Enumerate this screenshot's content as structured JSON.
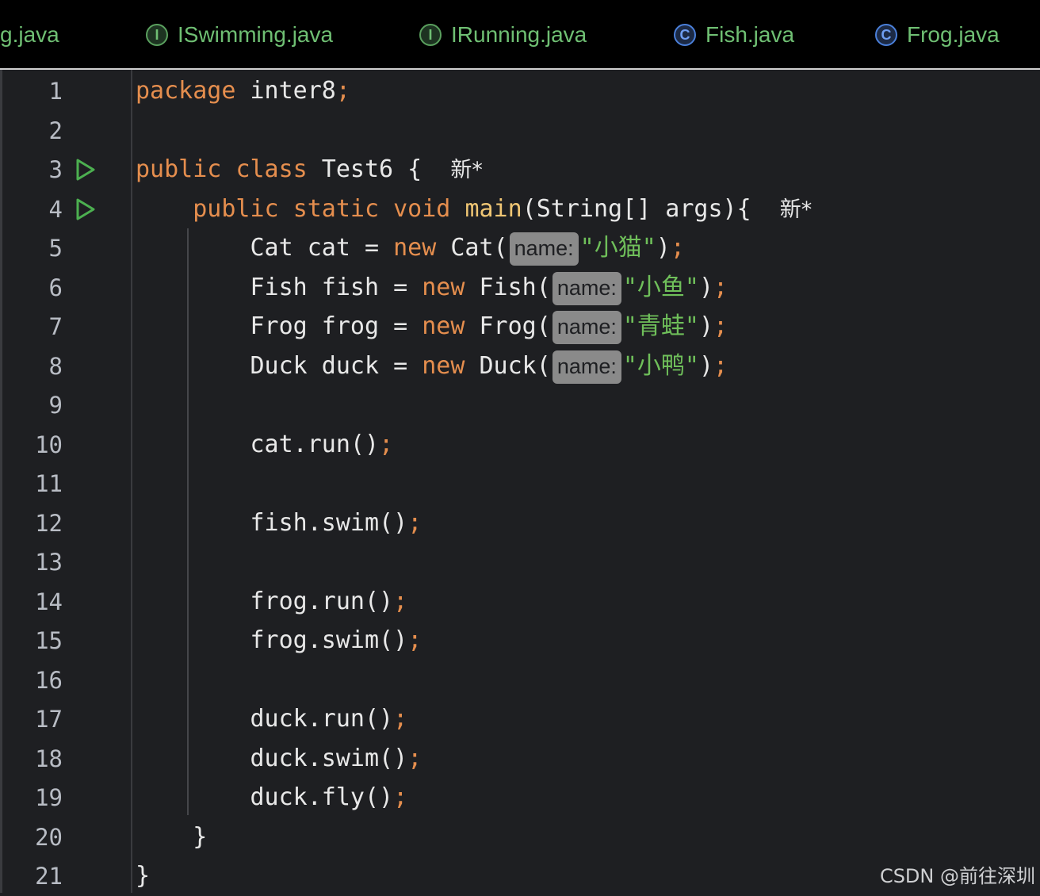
{
  "tabs": [
    {
      "label": "g.java",
      "icon": "none"
    },
    {
      "label": "ISwimming.java",
      "icon": "interface-icon",
      "glyph": "I"
    },
    {
      "label": "IRunning.java",
      "icon": "interface-icon",
      "glyph": "I"
    },
    {
      "label": "Fish.java",
      "icon": "class-icon",
      "glyph": "C"
    },
    {
      "label": "Frog.java",
      "icon": "class-icon",
      "glyph": "C"
    }
  ],
  "gutter": {
    "line_numbers": [
      "1",
      "2",
      "3",
      "4",
      "5",
      "6",
      "7",
      "8",
      "9",
      "10",
      "11",
      "12",
      "13",
      "14",
      "15",
      "16",
      "17",
      "18",
      "19",
      "20",
      "21"
    ]
  },
  "code": {
    "l1": {
      "kw": "package",
      "rest": " inter8",
      "semi": ";"
    },
    "l3": {
      "kw1": "public",
      "kw2": "class",
      "rest": " Test6 {",
      "mark": "新*"
    },
    "l4": {
      "kw1": "public",
      "kw2": "static",
      "kw3": "void",
      "fn": "main",
      "rest": "(String[] args){",
      "mark": "新*"
    },
    "l5": {
      "pre": "Cat cat = ",
      "kw": "new",
      "post": " Cat(",
      "hint": "name:",
      "str": "\"小猫\"",
      "close": ")",
      "semi": ";"
    },
    "l6": {
      "pre": "Fish fish = ",
      "kw": "new",
      "post": " Fish(",
      "hint": "name:",
      "str": "\"小鱼\"",
      "close": ")",
      "semi": ";"
    },
    "l7": {
      "pre": "Frog frog = ",
      "kw": "new",
      "post": " Frog(",
      "hint": "name:",
      "str": "\"青蛙\"",
      "close": ")",
      "semi": ";"
    },
    "l8": {
      "pre": "Duck duck = ",
      "kw": "new",
      "post": " Duck(",
      "hint": "name:",
      "str": "\"小鸭\"",
      "close": ")",
      "semi": ";"
    },
    "l10": {
      "text": "cat.run()",
      "semi": ";"
    },
    "l12": {
      "text": "fish.swim()",
      "semi": ";"
    },
    "l14": {
      "text": "frog.run()",
      "semi": ";"
    },
    "l15": {
      "text": "frog.swim()",
      "semi": ";"
    },
    "l17": {
      "text": "duck.run()",
      "semi": ";"
    },
    "l18": {
      "text": "duck.swim()",
      "semi": ";"
    },
    "l19": {
      "text": "duck.fly()",
      "semi": ";"
    },
    "l20": {
      "text": "}"
    },
    "l21": {
      "text": "}"
    }
  },
  "watermark": "CSDN @前往深圳",
  "colors": {
    "background": "#1e1f22",
    "keyword": "#e58e4e",
    "function": "#f0c674",
    "string": "#6fbf5a",
    "tab_text": "#6fbf73",
    "run_icon": "#4caf50"
  }
}
